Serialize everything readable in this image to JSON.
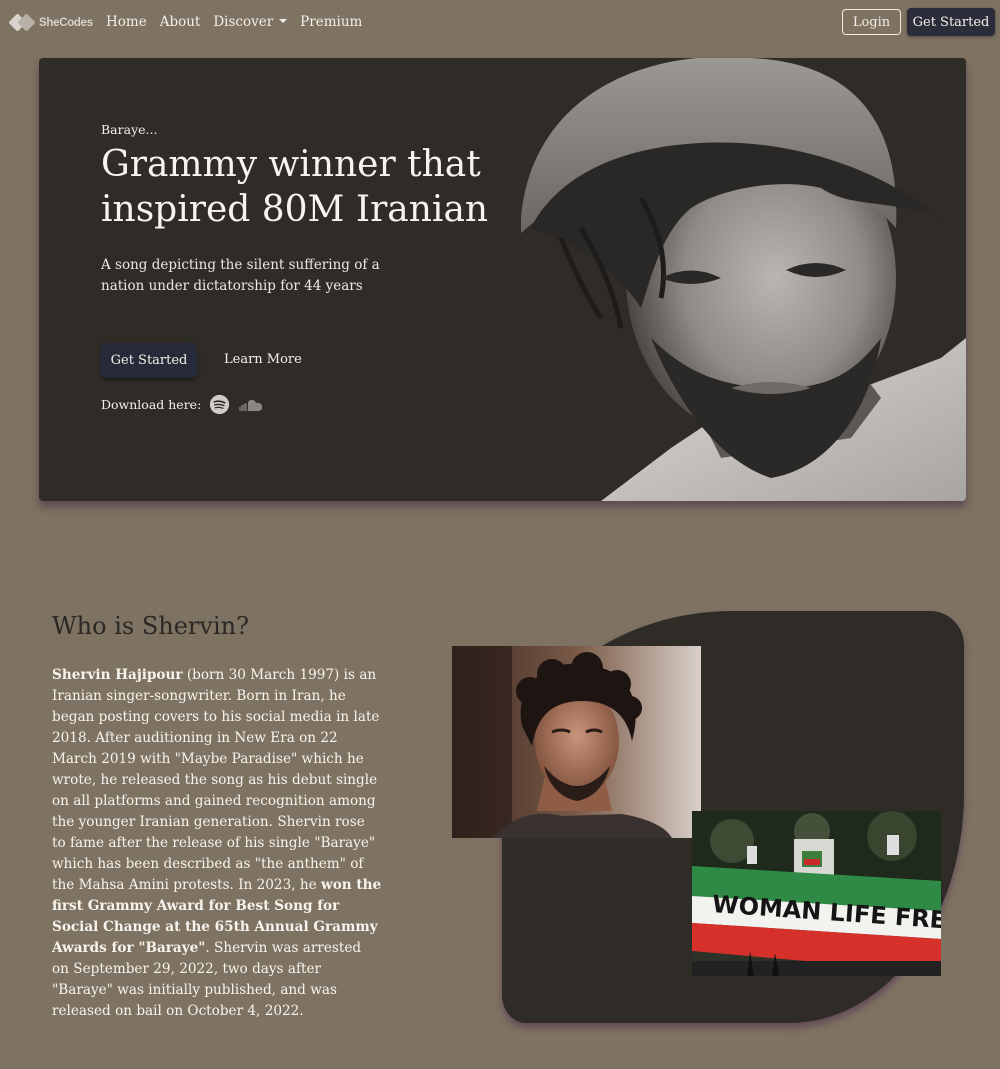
{
  "nav": {
    "brand": "SheCodes",
    "links": [
      "Home",
      "About",
      "Discover",
      "Premium"
    ],
    "login": "Login",
    "get_started": "Get Started"
  },
  "hero": {
    "kicker": "Baraye...",
    "title": "Grammy winner that inspired 80M Iranian",
    "subtitle": "A song depicting the silent suffering of a nation under dictatorship for 44 years",
    "primary_button": "Get Started",
    "secondary_button": "Learn More",
    "download_label": "Download here:",
    "icons": [
      "spotify-icon",
      "soundcloud-icon"
    ]
  },
  "about": {
    "title": "Who is Shervin?",
    "name": "Shervin Hajipour",
    "text1": " (born 30 March 1997) is an Iranian singer-songwriter. Born in Iran, he began posting covers to his social media in late 2018. After auditioning in New Era on 22 March 2019 with \"Maybe Paradise\" which he wrote, he released the song as his debut single on all platforms and gained recognition among the younger Iranian generation. Shervin rose to fame after the release of his single \"Baraye\" which has been described as \"the anthem\" of the Mahsa Amini protests. In 2023, he ",
    "highlight": "won the first Grammy Award for Best Song for Social Change at the 65th Annual Grammy Awards for \"Baraye\"",
    "text2": ". Shervin was arrested on September 29, 2022, two days after \"Baraye\" was initially published, and was released on bail on October 4, 2022.",
    "banner_text": "WOMAN LIFE FREEDOM"
  },
  "colors": {
    "page_bg": "#7e7262",
    "card_bg": "#2f2c28",
    "button_dark": "#2b2d3a",
    "heading_dark": "#2b2824"
  }
}
